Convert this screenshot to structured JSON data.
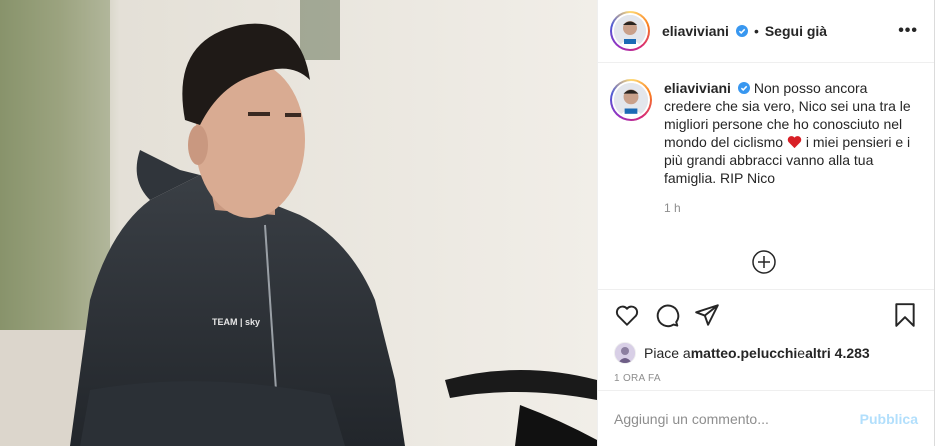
{
  "post": {
    "image_alt": "Cyclist in a dark TEAM SKY hoodie",
    "jacket_text": "TEAM | sky"
  },
  "header": {
    "username": "eliaviviani",
    "separator": "•",
    "follow_label": "Segui già",
    "more_label": "•••"
  },
  "caption": {
    "username": "eliaviviani",
    "text_before_emoji": "Non posso ancora credere che sia vero, Nico sei una tra le migliori persone che ho conosciuto nel mondo del ciclismo",
    "emoji": "heart-emoji",
    "text_after_emoji": " i miei pensieri e i più grandi abbracci vanno alla tua famiglia. RIP Nico",
    "time": "1 h"
  },
  "actions": {
    "icons": [
      "heart-icon",
      "comment-icon",
      "share-icon",
      "bookmark-icon"
    ]
  },
  "likes": {
    "prefix": "Piace a ",
    "user": "matteo.pelucchi",
    "connector": " e ",
    "others": "altri 4.283"
  },
  "timestamp": "1 ORA FA",
  "comment_box": {
    "placeholder": "Aggiungi un commento...",
    "publish_label": "Pubblica"
  },
  "colors": {
    "verified": "#3897f0",
    "publish_disabled": "#b2dffc",
    "secondary_text": "#8e8e8e"
  }
}
